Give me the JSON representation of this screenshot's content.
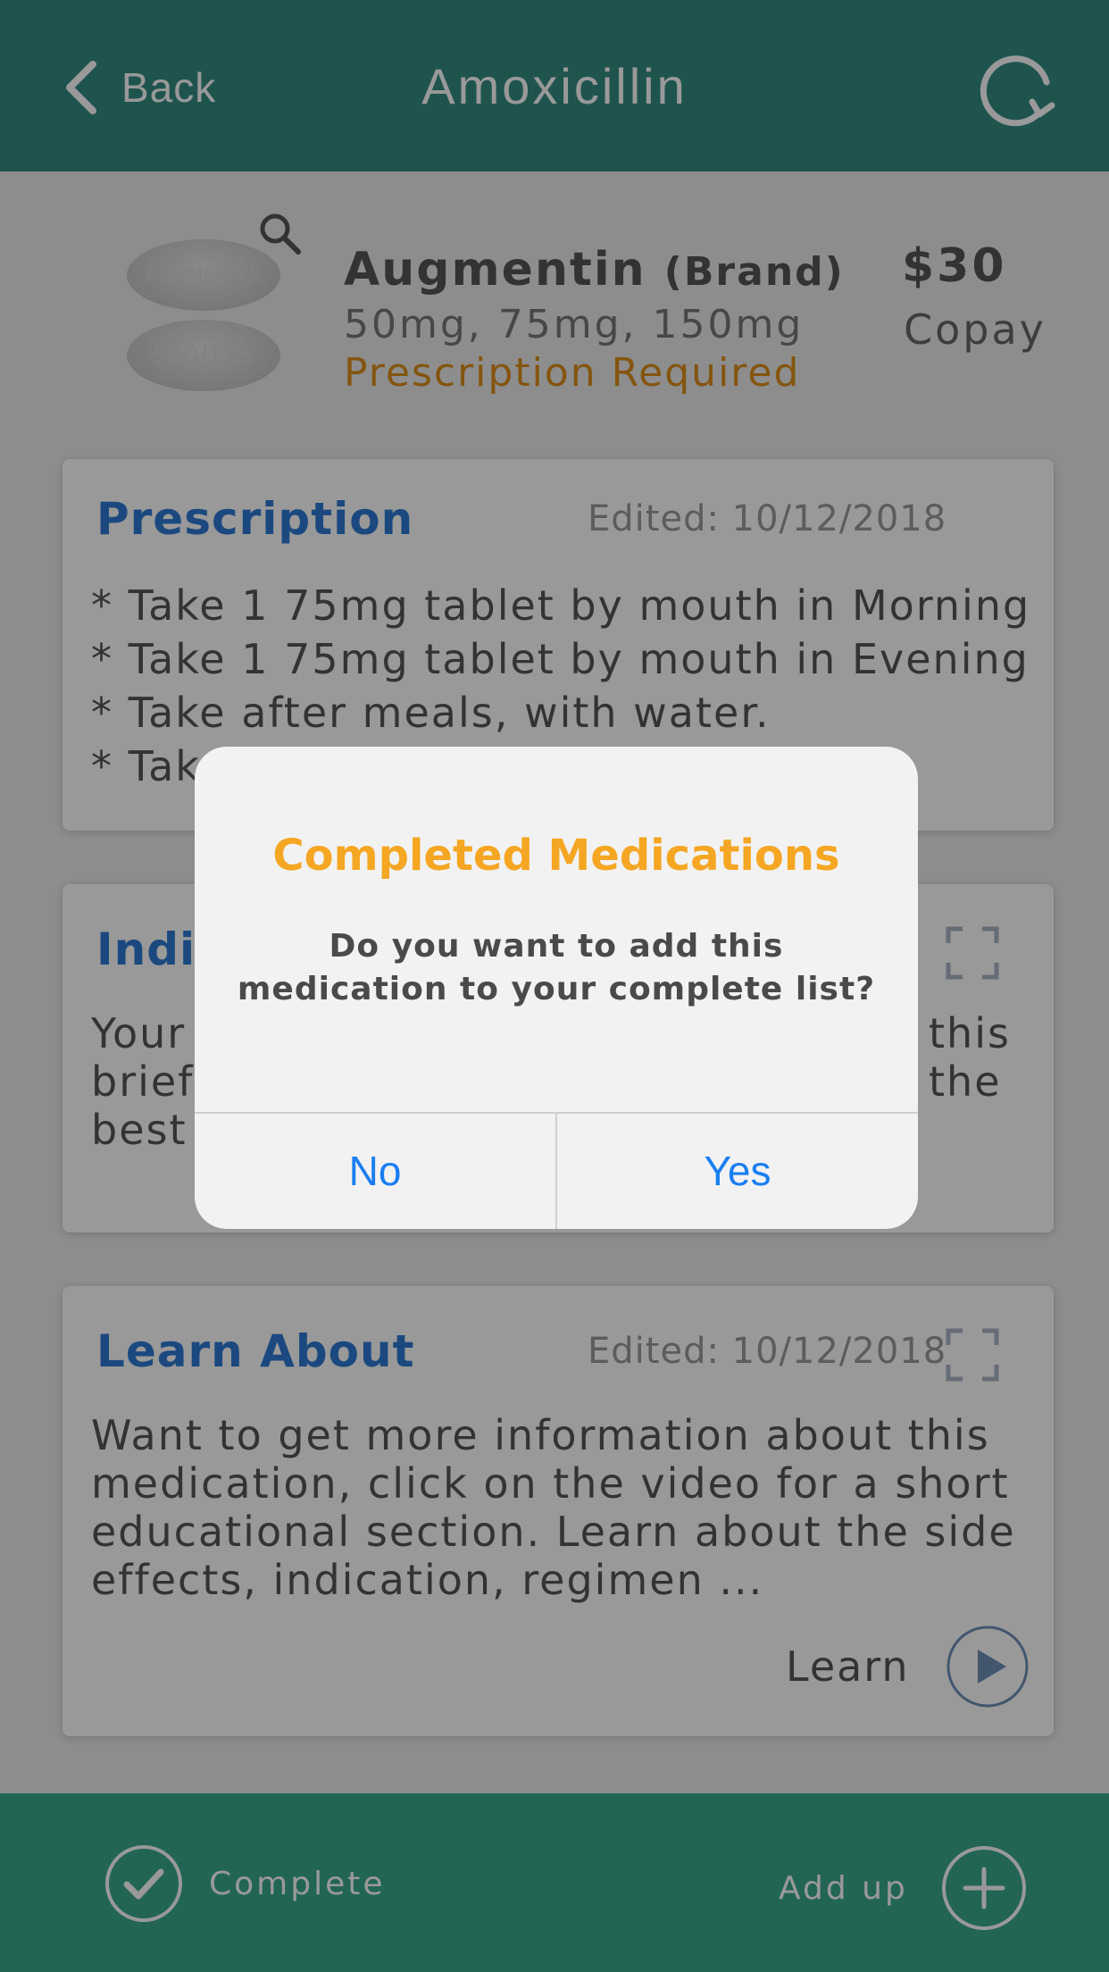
{
  "header": {
    "back_label": "Back",
    "title": "Amoxicillin",
    "back_icon": "chevron-left-icon",
    "refresh_icon": "refresh-icon"
  },
  "drug": {
    "pill_top_text": "AUGMENTIN",
    "pill_bottom_text": "500/125",
    "name": "Augmentin",
    "brand": "(Brand)",
    "doses": "50mg, 75mg, 150mg",
    "rx_status": "Prescription Required",
    "price": "$30",
    "price_label": "Copay"
  },
  "prescription": {
    "title": "Prescription",
    "edited": "Edited: 10/12/2018",
    "lines": [
      "* Take 1 75mg tablet by mouth in Morning",
      "* Take 1 75mg tablet by mouth in Evening",
      "* Take after meals, with water.",
      "* Tak"
    ]
  },
  "indication": {
    "title": "Indic",
    "lines": [
      "Your",
      "brief",
      "best"
    ],
    "lines_right": [
      "this",
      "the"
    ]
  },
  "learn": {
    "title": "Learn About",
    "edited": "Edited: 10/12/2018",
    "lines": [
      "Want to get more information about this",
      "medication, click on the video for a short",
      "educational section. Learn about the side",
      "effects, indication, regimen ..."
    ],
    "button_label": "Learn"
  },
  "footer": {
    "complete_label": "Complete",
    "addup_label": "Add up"
  },
  "dialog": {
    "title": "Completed Medications",
    "message_line1": "Do you want to add this",
    "message_line2": "medication to your complete list?",
    "no_label": "No",
    "yes_label": "Yes"
  },
  "colors": {
    "header": "#348c82",
    "footer": "#3aa88c",
    "card_title": "#2e7ad4",
    "rx_status": "#dc8e1a",
    "dialog_title": "#f5a623",
    "dialog_button": "#1a7ef0"
  }
}
